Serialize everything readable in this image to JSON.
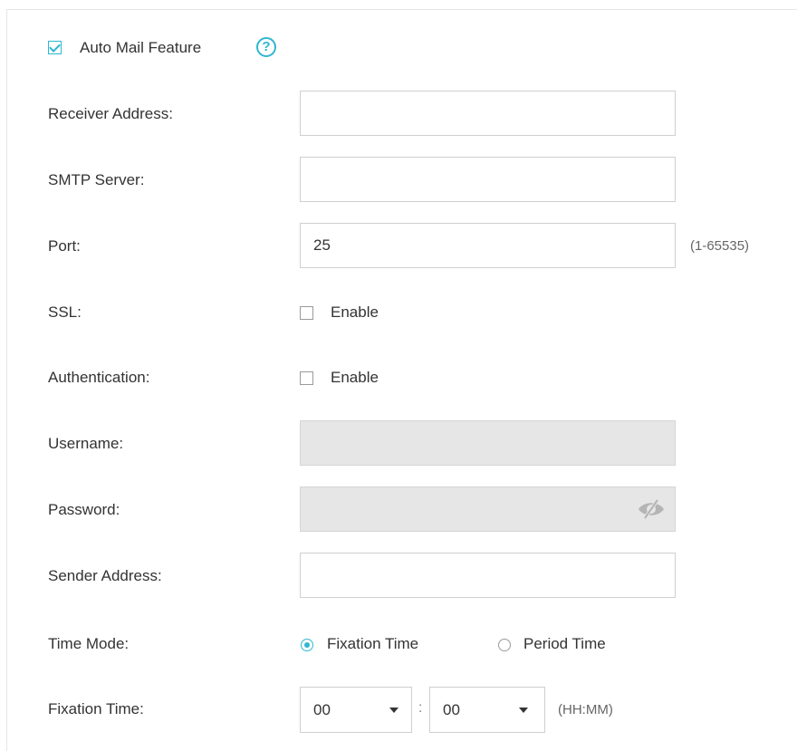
{
  "feature": {
    "label": "Auto Mail Feature",
    "checked": true,
    "help_icon": "question-circle-icon"
  },
  "fields": {
    "receiver_address": {
      "label": "Receiver Address:",
      "value": ""
    },
    "smtp_server": {
      "label": "SMTP Server:",
      "value": ""
    },
    "port": {
      "label": "Port:",
      "value": "25",
      "hint": "(1-65535)"
    },
    "ssl": {
      "label": "SSL:",
      "enable_label": "Enable",
      "checked": false
    },
    "authentication": {
      "label": "Authentication:",
      "enable_label": "Enable",
      "checked": false
    },
    "username": {
      "label": "Username:",
      "value": "",
      "disabled": true
    },
    "password": {
      "label": "Password:",
      "value": "",
      "disabled": true,
      "toggle_icon": "eye-slash-icon"
    },
    "sender_address": {
      "label": "Sender Address:",
      "value": ""
    }
  },
  "time_mode": {
    "label": "Time Mode:",
    "options": [
      "Fixation Time",
      "Period Time"
    ],
    "selected": "Fixation Time"
  },
  "fixation_time": {
    "label": "Fixation Time:",
    "hour": "00",
    "separator": ":",
    "minute": "00",
    "hint": "(HH:MM)"
  },
  "colors": {
    "accent": "#2fb7cf",
    "disabled_bg": "#e6e6e6",
    "border": "#cfcfcf"
  }
}
